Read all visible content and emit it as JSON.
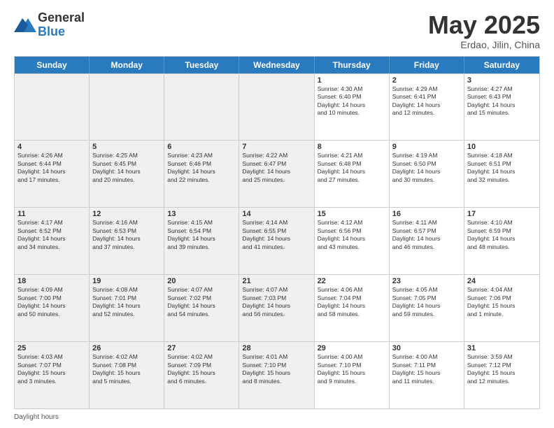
{
  "header": {
    "logo_general": "General",
    "logo_blue": "Blue",
    "month_title": "May 2025",
    "location": "Erdao, Jilin, China"
  },
  "days_of_week": [
    "Sunday",
    "Monday",
    "Tuesday",
    "Wednesday",
    "Thursday",
    "Friday",
    "Saturday"
  ],
  "footer_text": "Daylight hours",
  "weeks": [
    [
      {
        "day": "",
        "info": "",
        "shaded": true
      },
      {
        "day": "",
        "info": "",
        "shaded": true
      },
      {
        "day": "",
        "info": "",
        "shaded": true
      },
      {
        "day": "",
        "info": "",
        "shaded": true
      },
      {
        "day": "1",
        "info": "Sunrise: 4:30 AM\nSunset: 6:40 PM\nDaylight: 14 hours\nand 10 minutes.",
        "shaded": false
      },
      {
        "day": "2",
        "info": "Sunrise: 4:29 AM\nSunset: 6:41 PM\nDaylight: 14 hours\nand 12 minutes.",
        "shaded": false
      },
      {
        "day": "3",
        "info": "Sunrise: 4:27 AM\nSunset: 6:43 PM\nDaylight: 14 hours\nand 15 minutes.",
        "shaded": false
      }
    ],
    [
      {
        "day": "4",
        "info": "Sunrise: 4:26 AM\nSunset: 6:44 PM\nDaylight: 14 hours\nand 17 minutes.",
        "shaded": true
      },
      {
        "day": "5",
        "info": "Sunrise: 4:25 AM\nSunset: 6:45 PM\nDaylight: 14 hours\nand 20 minutes.",
        "shaded": true
      },
      {
        "day": "6",
        "info": "Sunrise: 4:23 AM\nSunset: 6:46 PM\nDaylight: 14 hours\nand 22 minutes.",
        "shaded": true
      },
      {
        "day": "7",
        "info": "Sunrise: 4:22 AM\nSunset: 6:47 PM\nDaylight: 14 hours\nand 25 minutes.",
        "shaded": true
      },
      {
        "day": "8",
        "info": "Sunrise: 4:21 AM\nSunset: 6:48 PM\nDaylight: 14 hours\nand 27 minutes.",
        "shaded": false
      },
      {
        "day": "9",
        "info": "Sunrise: 4:19 AM\nSunset: 6:50 PM\nDaylight: 14 hours\nand 30 minutes.",
        "shaded": false
      },
      {
        "day": "10",
        "info": "Sunrise: 4:18 AM\nSunset: 6:51 PM\nDaylight: 14 hours\nand 32 minutes.",
        "shaded": false
      }
    ],
    [
      {
        "day": "11",
        "info": "Sunrise: 4:17 AM\nSunset: 6:52 PM\nDaylight: 14 hours\nand 34 minutes.",
        "shaded": true
      },
      {
        "day": "12",
        "info": "Sunrise: 4:16 AM\nSunset: 6:53 PM\nDaylight: 14 hours\nand 37 minutes.",
        "shaded": true
      },
      {
        "day": "13",
        "info": "Sunrise: 4:15 AM\nSunset: 6:54 PM\nDaylight: 14 hours\nand 39 minutes.",
        "shaded": true
      },
      {
        "day": "14",
        "info": "Sunrise: 4:14 AM\nSunset: 6:55 PM\nDaylight: 14 hours\nand 41 minutes.",
        "shaded": true
      },
      {
        "day": "15",
        "info": "Sunrise: 4:12 AM\nSunset: 6:56 PM\nDaylight: 14 hours\nand 43 minutes.",
        "shaded": false
      },
      {
        "day": "16",
        "info": "Sunrise: 4:11 AM\nSunset: 6:57 PM\nDaylight: 14 hours\nand 46 minutes.",
        "shaded": false
      },
      {
        "day": "17",
        "info": "Sunrise: 4:10 AM\nSunset: 6:59 PM\nDaylight: 14 hours\nand 48 minutes.",
        "shaded": false
      }
    ],
    [
      {
        "day": "18",
        "info": "Sunrise: 4:09 AM\nSunset: 7:00 PM\nDaylight: 14 hours\nand 50 minutes.",
        "shaded": true
      },
      {
        "day": "19",
        "info": "Sunrise: 4:08 AM\nSunset: 7:01 PM\nDaylight: 14 hours\nand 52 minutes.",
        "shaded": true
      },
      {
        "day": "20",
        "info": "Sunrise: 4:07 AM\nSunset: 7:02 PM\nDaylight: 14 hours\nand 54 minutes.",
        "shaded": true
      },
      {
        "day": "21",
        "info": "Sunrise: 4:07 AM\nSunset: 7:03 PM\nDaylight: 14 hours\nand 56 minutes.",
        "shaded": true
      },
      {
        "day": "22",
        "info": "Sunrise: 4:06 AM\nSunset: 7:04 PM\nDaylight: 14 hours\nand 58 minutes.",
        "shaded": false
      },
      {
        "day": "23",
        "info": "Sunrise: 4:05 AM\nSunset: 7:05 PM\nDaylight: 14 hours\nand 59 minutes.",
        "shaded": false
      },
      {
        "day": "24",
        "info": "Sunrise: 4:04 AM\nSunset: 7:06 PM\nDaylight: 15 hours\nand 1 minute.",
        "shaded": false
      }
    ],
    [
      {
        "day": "25",
        "info": "Sunrise: 4:03 AM\nSunset: 7:07 PM\nDaylight: 15 hours\nand 3 minutes.",
        "shaded": true
      },
      {
        "day": "26",
        "info": "Sunrise: 4:02 AM\nSunset: 7:08 PM\nDaylight: 15 hours\nand 5 minutes.",
        "shaded": true
      },
      {
        "day": "27",
        "info": "Sunrise: 4:02 AM\nSunset: 7:09 PM\nDaylight: 15 hours\nand 6 minutes.",
        "shaded": true
      },
      {
        "day": "28",
        "info": "Sunrise: 4:01 AM\nSunset: 7:10 PM\nDaylight: 15 hours\nand 8 minutes.",
        "shaded": true
      },
      {
        "day": "29",
        "info": "Sunrise: 4:00 AM\nSunset: 7:10 PM\nDaylight: 15 hours\nand 9 minutes.",
        "shaded": false
      },
      {
        "day": "30",
        "info": "Sunrise: 4:00 AM\nSunset: 7:11 PM\nDaylight: 15 hours\nand 11 minutes.",
        "shaded": false
      },
      {
        "day": "31",
        "info": "Sunrise: 3:59 AM\nSunset: 7:12 PM\nDaylight: 15 hours\nand 12 minutes.",
        "shaded": false
      }
    ]
  ]
}
